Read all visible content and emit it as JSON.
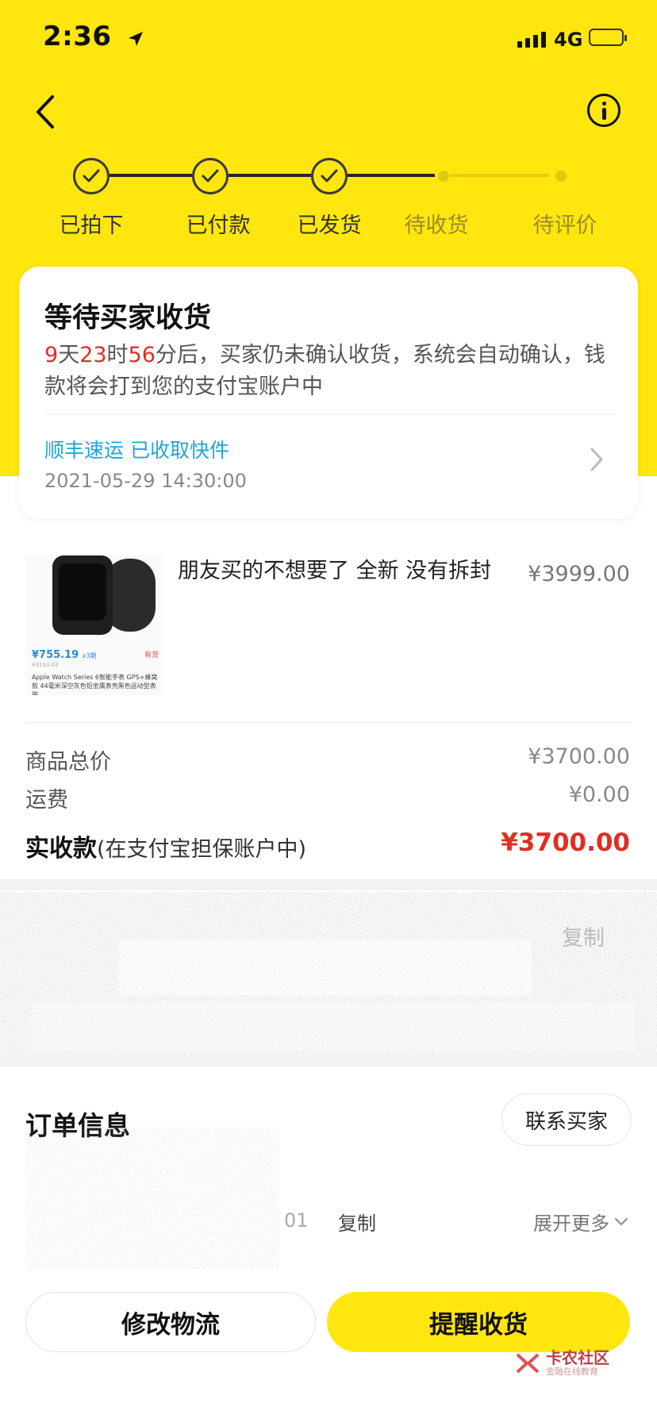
{
  "status_bar": {
    "time": "2:36",
    "network": "4G"
  },
  "progress": {
    "steps": [
      {
        "label": "已拍下",
        "state": "done"
      },
      {
        "label": "已付款",
        "state": "done"
      },
      {
        "label": "已发货",
        "state": "done"
      },
      {
        "label": "待收货",
        "state": "pending"
      },
      {
        "label": "待评价",
        "state": "pending"
      }
    ]
  },
  "status_card": {
    "title": "等待买家收货",
    "countdown": {
      "days": "9",
      "day_unit": "天",
      "hours": "23",
      "hour_unit": "时",
      "minutes": "56",
      "minute_unit": "分后，"
    },
    "desc_rest": "买家仍未确认收货，系统会自动确认，钱款将会打到您的支付宝账户中",
    "logistics_status": "顺丰速运 已收取快件",
    "logistics_time": "2021-05-29 14:30:00"
  },
  "product": {
    "title": "朋友买的不想要了 全新 没有拆封",
    "price": "¥3999.00",
    "image_overlay": {
      "price": "¥755.19",
      "price_suffix": "x3期",
      "tag": "有货",
      "sub": "¥3193.03",
      "text": "Apple Watch Series 6智能手表 GPS+蜂窝款 44毫米深空灰色铝金属表壳黑色运动型表带"
    }
  },
  "summary": {
    "goods_total_label": "商品总价",
    "goods_total_value": "¥3700.00",
    "shipping_label": "运费",
    "shipping_value": "¥0.00",
    "received_label": "实收款",
    "received_note": "(在支付宝担保账户中)",
    "received_value": "¥3700.00"
  },
  "address": {
    "copy_label": "复制"
  },
  "order_info": {
    "title": "订单信息",
    "contact_button": "联系买家",
    "order_no_partial": "01",
    "copy_label": "复制",
    "expand_label": "展开更多"
  },
  "actions": {
    "modify_logistics": "修改物流",
    "remind_receipt": "提醒收货"
  },
  "watermark": {
    "main": "卡农社区",
    "sub": "金融在线教育"
  },
  "colors": {
    "brand_yellow": "#FFE60F",
    "alert_red": "#E02E24",
    "link_blue": "#1ea7d6"
  }
}
